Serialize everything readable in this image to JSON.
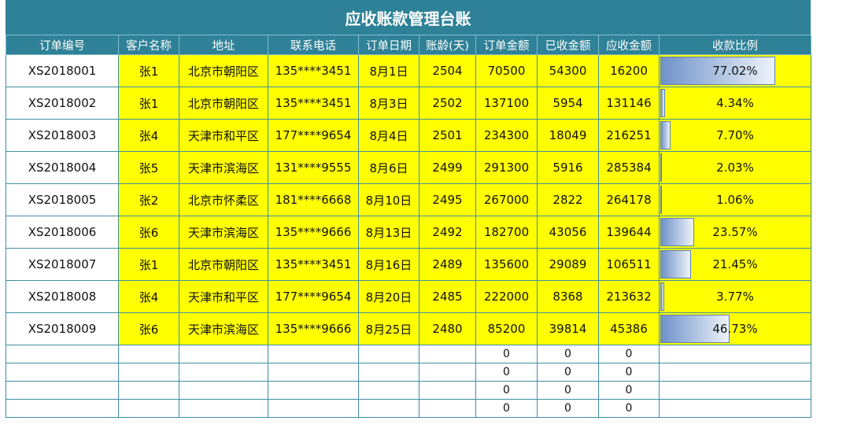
{
  "title": "应收账款管理台账",
  "columns": [
    "订单编号",
    "客户名称",
    "地址",
    "联系电话",
    "订单日期",
    "账龄(天)",
    "订单金额",
    "已收金额",
    "应收金额",
    "收款比例"
  ],
  "rows": [
    {
      "order_no": "XS2018001",
      "customer": "张1",
      "address": "北京市朝阳区",
      "phone": "135****3451",
      "date": "8月1日",
      "age": "2504",
      "order_amount": "70500",
      "received": "54300",
      "receivable": "16200",
      "ratio_text": "77.02%",
      "ratio": 0.7702
    },
    {
      "order_no": "XS2018002",
      "customer": "张1",
      "address": "北京市朝阳区",
      "phone": "135****3451",
      "date": "8月3日",
      "age": "2502",
      "order_amount": "137100",
      "received": "5954",
      "receivable": "131146",
      "ratio_text": "4.34%",
      "ratio": 0.0434
    },
    {
      "order_no": "XS2018003",
      "customer": "张4",
      "address": "天津市和平区",
      "phone": "177****9654",
      "date": "8月4日",
      "age": "2501",
      "order_amount": "234300",
      "received": "18049",
      "receivable": "216251",
      "ratio_text": "7.70%",
      "ratio": 0.077
    },
    {
      "order_no": "XS2018004",
      "customer": "张5",
      "address": "天津市滨海区",
      "phone": "131****9555",
      "date": "8月6日",
      "age": "2499",
      "order_amount": "291300",
      "received": "5916",
      "receivable": "285384",
      "ratio_text": "2.03%",
      "ratio": 0.0203
    },
    {
      "order_no": "XS2018005",
      "customer": "张2",
      "address": "北京市怀柔区",
      "phone": "181****6668",
      "date": "8月10日",
      "age": "2495",
      "order_amount": "267000",
      "received": "2822",
      "receivable": "264178",
      "ratio_text": "1.06%",
      "ratio": 0.0106
    },
    {
      "order_no": "XS2018006",
      "customer": "张6",
      "address": "天津市滨海区",
      "phone": "135****9666",
      "date": "8月13日",
      "age": "2492",
      "order_amount": "182700",
      "received": "43056",
      "receivable": "139644",
      "ratio_text": "23.57%",
      "ratio": 0.2357
    },
    {
      "order_no": "XS2018007",
      "customer": "张1",
      "address": "北京市朝阳区",
      "phone": "135****3451",
      "date": "8月16日",
      "age": "2489",
      "order_amount": "135600",
      "received": "29089",
      "receivable": "106511",
      "ratio_text": "21.45%",
      "ratio": 0.2145
    },
    {
      "order_no": "XS2018008",
      "customer": "张4",
      "address": "天津市和平区",
      "phone": "177****9654",
      "date": "8月20日",
      "age": "2485",
      "order_amount": "222000",
      "received": "8368",
      "receivable": "213632",
      "ratio_text": "3.77%",
      "ratio": 0.0377
    },
    {
      "order_no": "XS2018009",
      "customer": "张6",
      "address": "天津市滨海区",
      "phone": "135****9666",
      "date": "8月25日",
      "age": "2480",
      "order_amount": "85200",
      "received": "39814",
      "receivable": "45386",
      "ratio_text": "46.73%",
      "ratio": 0.4673
    }
  ],
  "empty_rows": [
    {
      "order_amount": "0",
      "received": "0",
      "receivable": "0"
    },
    {
      "order_amount": "0",
      "received": "0",
      "receivable": "0"
    },
    {
      "order_amount": "0",
      "received": "0",
      "receivable": "0"
    },
    {
      "order_amount": "0",
      "received": "0",
      "receivable": "0"
    }
  ],
  "colors": {
    "header": "#2e8196",
    "highlight": "#ffff00",
    "bar": "#6f92c9"
  }
}
